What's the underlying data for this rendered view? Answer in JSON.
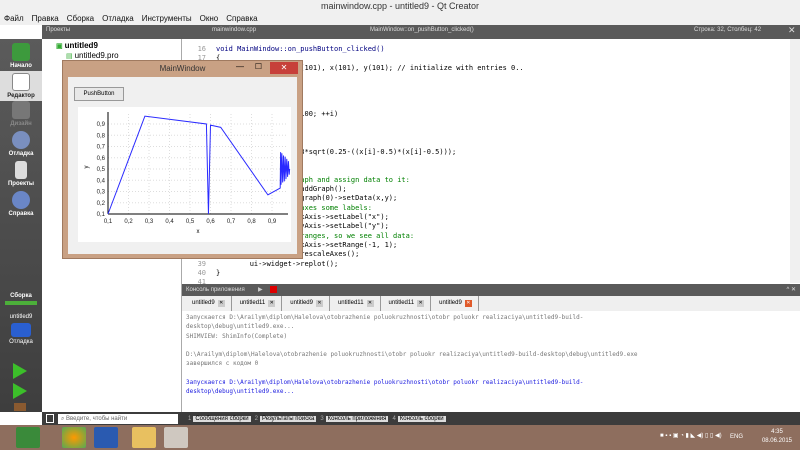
{
  "window": {
    "title": "mainwindow.cpp - untitled9 - Qt Creator"
  },
  "menu": [
    "Файл",
    "Правка",
    "Сборка",
    "Отладка",
    "Инструменты",
    "Окно",
    "Справка"
  ],
  "toolbar": {
    "projects_label": "Проекты",
    "file_tab": "mainwindow.cpp",
    "function": "MainWindow::on_pushButton_clicked()",
    "cursor": "Строка: 32, Столбец: 42"
  },
  "sidebar": {
    "items": [
      "Начало",
      "Редактор",
      "Дизайн",
      "Отладка",
      "Проекты",
      "Справка"
    ],
    "build_label": "Сборка",
    "target": "untitled9",
    "debug_label": "Отладка"
  },
  "project_tree": {
    "root": "untitled9",
    "pro_file": "untitled9.pro"
  },
  "editor": {
    "first_line": 16,
    "line_count": 26,
    "lines": [
      {
        "t": "void MainWindow::on_pushButton_clicked()",
        "c": "kw"
      },
      {
        "t": "{",
        "c": ""
      },
      {
        "t": "                   t(101), x(101), y(101); // initialize with entries 0..",
        "c": ""
      },
      {
        "t": "",
        "c": ""
      },
      {
        "t": "",
        "c": ""
      },
      {
        "t": "",
        "c": ""
      },
      {
        "t": "",
        "c": ""
      },
      {
        "t": "                   <100; ++i)",
        "c": ""
      },
      {
        "t": "",
        "c": ""
      },
      {
        "t": "",
        "c": ""
      },
      {
        "t": "",
        "c": ""
      },
      {
        "t": "                   98*sqrt(0.25-((x[i]-0.5)*(x[i]-0.5)));",
        "c": ""
      },
      {
        "t": "                   ;",
        "c": ""
      },
      {
        "t": "",
        "c": ""
      },
      {
        "t": "                   raph and assign data to it:",
        "c": "cm"
      },
      {
        "t": "                   >addGraph();",
        "c": ""
      },
      {
        "t": "                   >graph(0)->setData(x,y);",
        "c": ""
      },
      {
        "t": "                    axes some labels:",
        "c": "cm"
      },
      {
        "t": "                   >xAxis->setLabel(\"x\");",
        "c": ""
      },
      {
        "t": "                   >yAxis->setLabel(\"y\");",
        "c": ""
      },
      {
        "t": "                    ranges, so we see all data:",
        "c": "cm"
      },
      {
        "t": "                   >xAxis->setRange(-1, 1);",
        "c": ""
      },
      {
        "t": "                   >rescaleAxes();",
        "c": ""
      },
      {
        "t": "        ui->widget->replot();",
        "c": ""
      },
      {
        "t": "}",
        "c": ""
      },
      {
        "t": "",
        "c": ""
      }
    ]
  },
  "mainwindow": {
    "title": "MainWindow",
    "button": "PushButton"
  },
  "chart_data": {
    "type": "line",
    "xlabel": "x",
    "ylabel": "y",
    "xticks": [
      "0,1",
      "0,2",
      "0,3",
      "0,4",
      "0,5",
      "0,6",
      "0,7",
      "0,8",
      "0,9"
    ],
    "yticks": [
      "0,1",
      "0,2",
      "0,3",
      "0,4",
      "0,5",
      "0,6",
      "0,7",
      "0,8",
      "0,9"
    ],
    "xlim": [
      0.1,
      0.99
    ],
    "ylim": [
      0.1,
      0.98
    ],
    "x": [
      0.1,
      0.28,
      0.58,
      0.59,
      0.6,
      0.65,
      0.88,
      0.94,
      0.942,
      0.944,
      0.948,
      0.952,
      0.956,
      0.96,
      0.964,
      0.968,
      0.972,
      0.976,
      0.98,
      0.984,
      0.986
    ],
    "y": [
      0.1,
      0.97,
      0.9,
      0.1,
      0.89,
      0.87,
      0.27,
      0.33,
      0.65,
      0.36,
      0.64,
      0.38,
      0.62,
      0.39,
      0.61,
      0.41,
      0.59,
      0.43,
      0.57,
      0.45,
      0.5
    ]
  },
  "console": {
    "title": "Консоль приложения",
    "tabs": [
      "untitled9",
      "untitled11",
      "untitled9",
      "untitled11",
      "untitled11",
      "untitled9"
    ],
    "lines": [
      "Запускается D:\\Arailym\\diplom\\Halelova\\otobrazhenie poluokruzhnosti\\otobr poluokr realizaciya\\untitled9-build-",
      "desktop\\debug\\untitled9.exe...",
      "SHIMVIEW: ShimInfo(Complete)",
      "",
      "D:\\Arailym\\diplom\\Halelova\\otobrazhenie poluokruzhnosti\\otobr poluokr realizaciya\\untitled9-build-desktop\\debug\\untitled9.exe",
      "завершился с кодом 0",
      "",
      "Запускается D:\\Arailym\\diplom\\Halelova\\otobrazhenie poluokruzhnosti\\otobr poluokr realizaciya\\untitled9-build-",
      "desktop\\debug\\untitled9.exe..."
    ]
  },
  "bottom": {
    "search_placeholder": "Введите, чтобы найти",
    "panes": [
      {
        "n": "1",
        "l": "Сообщения сборки"
      },
      {
        "n": "2",
        "l": "Результаты поиска"
      },
      {
        "n": "3",
        "l": "Консоль приложения"
      },
      {
        "n": "4",
        "l": "Консоль сборки"
      }
    ]
  },
  "taskbar": {
    "lang": "ENG",
    "time": "4:35",
    "date": "08.06.2015"
  }
}
